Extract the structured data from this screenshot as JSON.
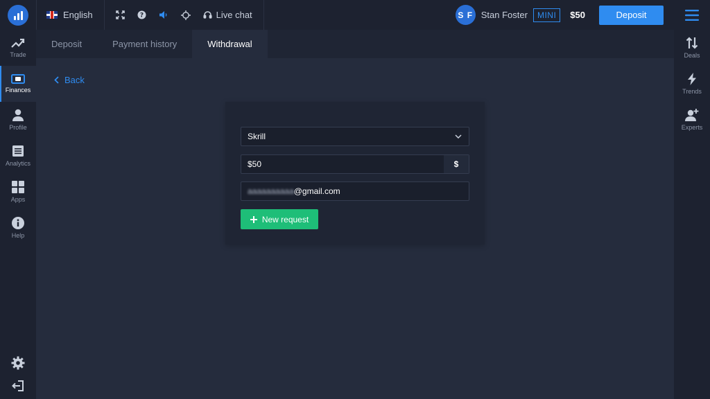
{
  "header": {
    "language": "English",
    "live_chat": "Live chat",
    "user_initials": "S F",
    "user_name": "Stan Foster",
    "account_badge": "MINI",
    "balance": "$50",
    "deposit_label": "Deposit",
    "icons": [
      "logo-icon",
      "uk-flag-icon",
      "fullscreen-icon",
      "help-icon",
      "sound-icon",
      "crosshair-icon",
      "headset-icon",
      "hamburger-menu-icon"
    ]
  },
  "left_nav": [
    {
      "label": "Trade",
      "icon": "trend-up-icon",
      "active": false
    },
    {
      "label": "Finances",
      "icon": "wallet-icon",
      "active": true
    },
    {
      "label": "Profile",
      "icon": "user-icon",
      "active": false
    },
    {
      "label": "Analytics",
      "icon": "news-icon",
      "active": false
    },
    {
      "label": "Apps",
      "icon": "grid-icon",
      "active": false
    },
    {
      "label": "Help",
      "icon": "info-icon",
      "active": false
    }
  ],
  "right_nav": [
    {
      "label": "Deals",
      "icon": "sort-arrows-icon"
    },
    {
      "label": "Trends",
      "icon": "lightning-icon"
    },
    {
      "label": "Experts",
      "icon": "add-user-icon"
    }
  ],
  "tabs": [
    {
      "label": "Deposit",
      "active": false
    },
    {
      "label": "Payment history",
      "active": false
    },
    {
      "label": "Withdrawal",
      "active": true
    }
  ],
  "back_label": "Back",
  "form": {
    "method": "Skrill",
    "amount": "$50",
    "currency_symbol": "$",
    "email_hidden_part": "aaaaaaaaaa",
    "email_domain": "@gmail.com",
    "submit_label": "New request"
  },
  "colors": {
    "accent": "#2f8cf0",
    "success": "#1ebe78",
    "bar_bg": "#1d2230",
    "page_bg": "#252c3d"
  }
}
